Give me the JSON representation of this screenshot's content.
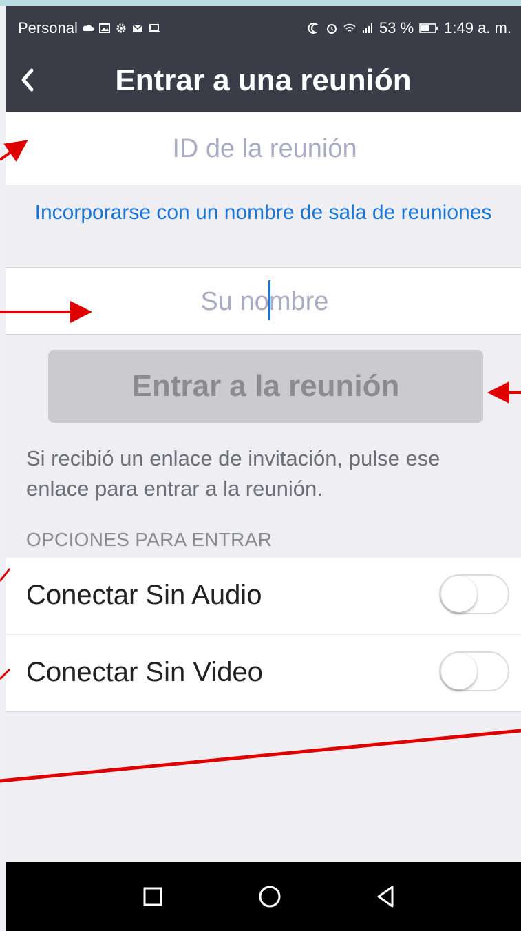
{
  "status_bar": {
    "carrier": "Personal",
    "battery": "53 %",
    "time": "1:49 a. m."
  },
  "nav": {
    "title": "Entrar a una reunión"
  },
  "meeting_id": {
    "placeholder": "ID de la reunión"
  },
  "room_link": {
    "label": "Incorporarse con un nombre de sala de reuniones"
  },
  "name_field": {
    "placeholder": "Su nombre"
  },
  "join_button": {
    "label": "Entrar a la reunión",
    "enabled": false
  },
  "hint": "Si recibió un enlace de invitación, pulse ese enlace para entrar a la reunión.",
  "options_header": "OPCIONES PARA ENTRAR",
  "options": [
    {
      "label": "Conectar Sin Audio",
      "enabled": false
    },
    {
      "label": "Conectar Sin Video",
      "enabled": false
    }
  ],
  "colors": {
    "header_bg": "#3a3d48",
    "link": "#1a76d6",
    "annotation_arrow": "#e00000"
  },
  "icons": {
    "back": "chevron-left-icon",
    "nav_recent": "square-icon",
    "nav_home": "circle-icon",
    "nav_back": "triangle-back-icon"
  }
}
